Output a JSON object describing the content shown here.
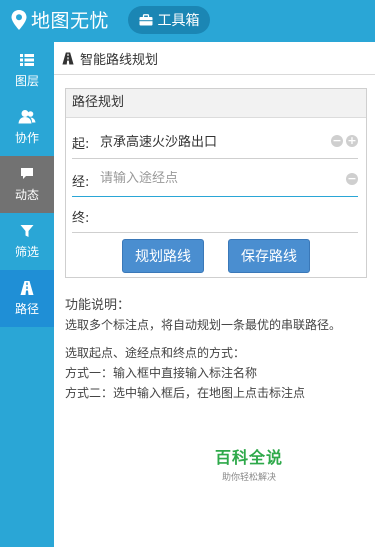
{
  "header": {
    "app_title": "地图无忧",
    "toolbox_label": "工具箱"
  },
  "sidebar": {
    "items": [
      {
        "label": "图层",
        "icon": "list-icon"
      },
      {
        "label": "协作",
        "icon": "users-icon"
      },
      {
        "label": "动态",
        "icon": "chat-icon"
      },
      {
        "label": "筛选",
        "icon": "filter-icon"
      },
      {
        "label": "路径",
        "icon": "road-icon"
      }
    ]
  },
  "main": {
    "section_title": "智能路线规划",
    "panel": {
      "title": "路径规划",
      "start_label": "起:",
      "start_value": "京承高速火沙路出口",
      "via_label": "经:",
      "via_placeholder": "请输入途经点",
      "end_label": "终:",
      "plan_button": "规划路线",
      "save_button": "保存路线"
    },
    "description": {
      "heading": "功能说明：",
      "line1": "选取多个标注点，将自动规划一条最优的串联路径。",
      "line2": "选取起点、途经点和终点的方式：",
      "line3": "方式一：输入框中直接输入标注名称",
      "line4": "方式二：选中输入框后，在地图上点击标注点"
    }
  },
  "watermark": {
    "title": "百科全说",
    "subtitle": "助你轻松解决"
  },
  "colors": {
    "primary": "#2aa6d6",
    "selected_nav": "#1f8fd6",
    "active_nav_gray": "#727272",
    "button": "#4a8ed0"
  }
}
